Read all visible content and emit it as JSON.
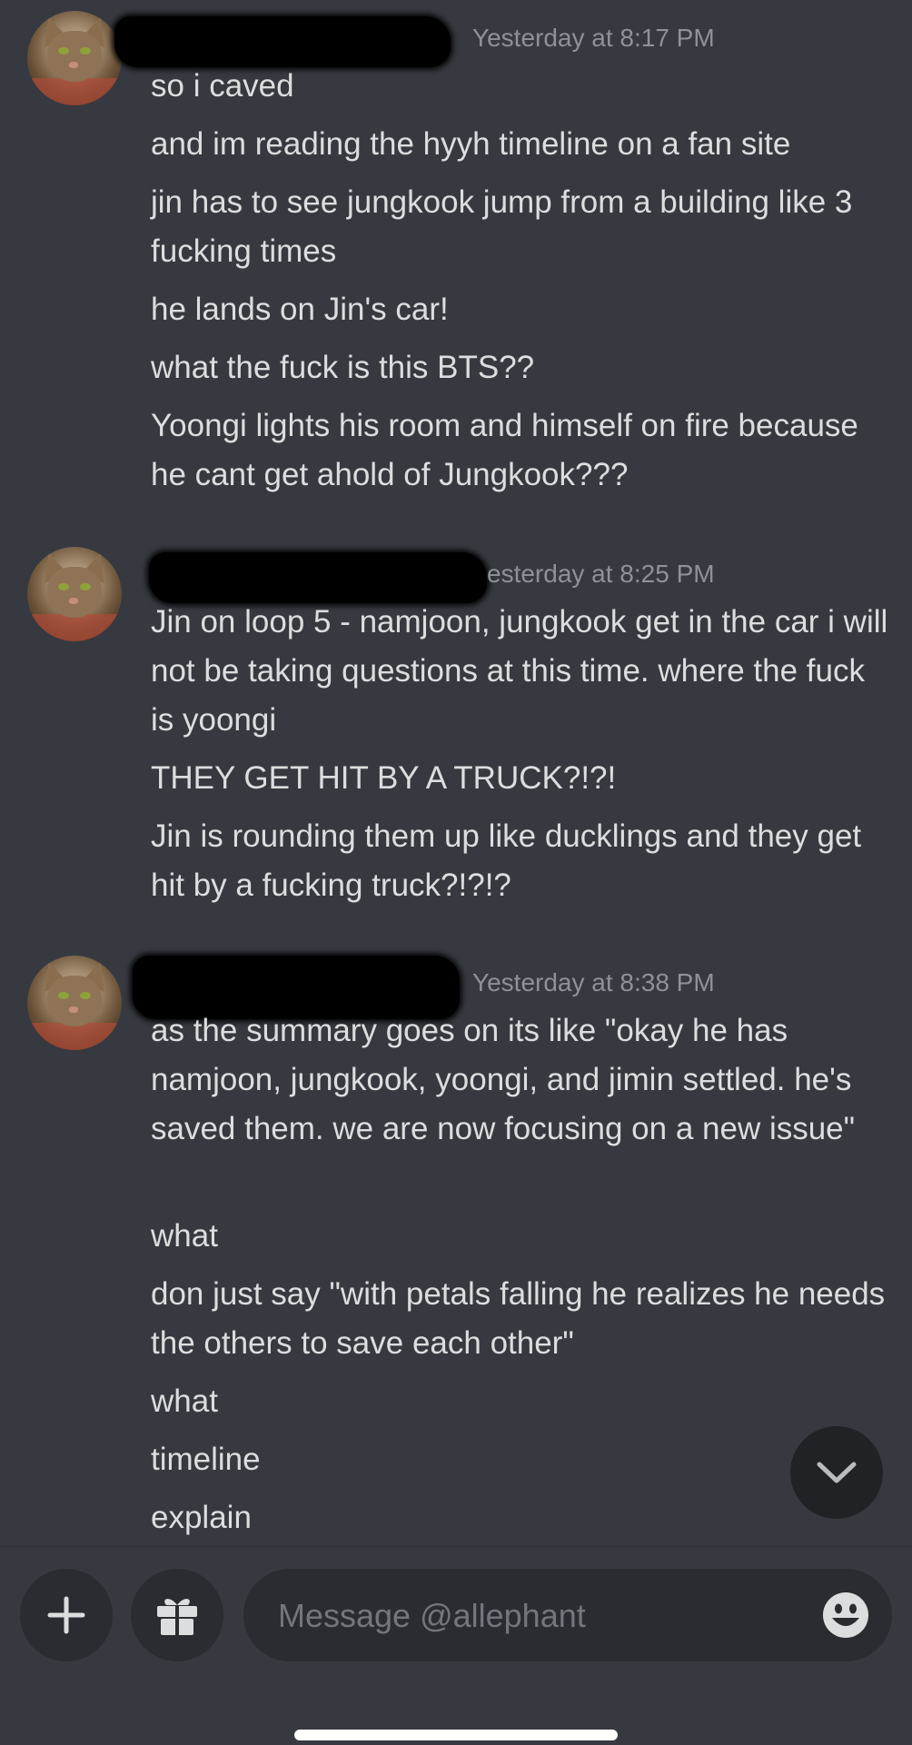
{
  "chat": {
    "groups": [
      {
        "timestamp": "Yesterday at 8:17 PM",
        "messages": [
          "so i caved",
          "and im reading the hyyh timeline on a fan site",
          "jin has to see jungkook jump from a building like 3 fucking times",
          "he lands on Jin's car!",
          "what the fuck is this BTS??",
          "Yoongi lights his room and himself on fire because he cant get ahold of Jungkook???"
        ]
      },
      {
        "timestamp": "esterday at 8:25 PM",
        "messages": [
          "Jin on loop 5 - namjoon, jungkook get in the car i will not be taking questions at this time. where the fuck is yoongi",
          "THEY GET HIT BY A TRUCK?!?!",
          "Jin is rounding them up like ducklings and they get hit by a fucking truck?!?!?"
        ]
      },
      {
        "timestamp": "Yesterday at 8:38 PM",
        "messages": [
          "as the summary goes on its like \"okay he has namjoon, jungkook, yoongi, and jimin settled. he's saved them. we are now focusing on a new issue\"",
          "what",
          "don just say \"with petals falling he realizes he needs the others to save each other\"",
          "what",
          "timeline",
          "explain"
        ]
      }
    ]
  },
  "composer": {
    "placeholder": "Message @allephant"
  },
  "icons": {
    "add": "plus-icon",
    "gift": "gift-icon",
    "emoji": "emoji-icon",
    "scroll": "chevron-down-icon"
  },
  "colors": {
    "background": "#36393f",
    "input_background": "#2a2c31",
    "text": "#dcddde",
    "timestamp": "#8e9297",
    "placeholder": "#72767d"
  }
}
